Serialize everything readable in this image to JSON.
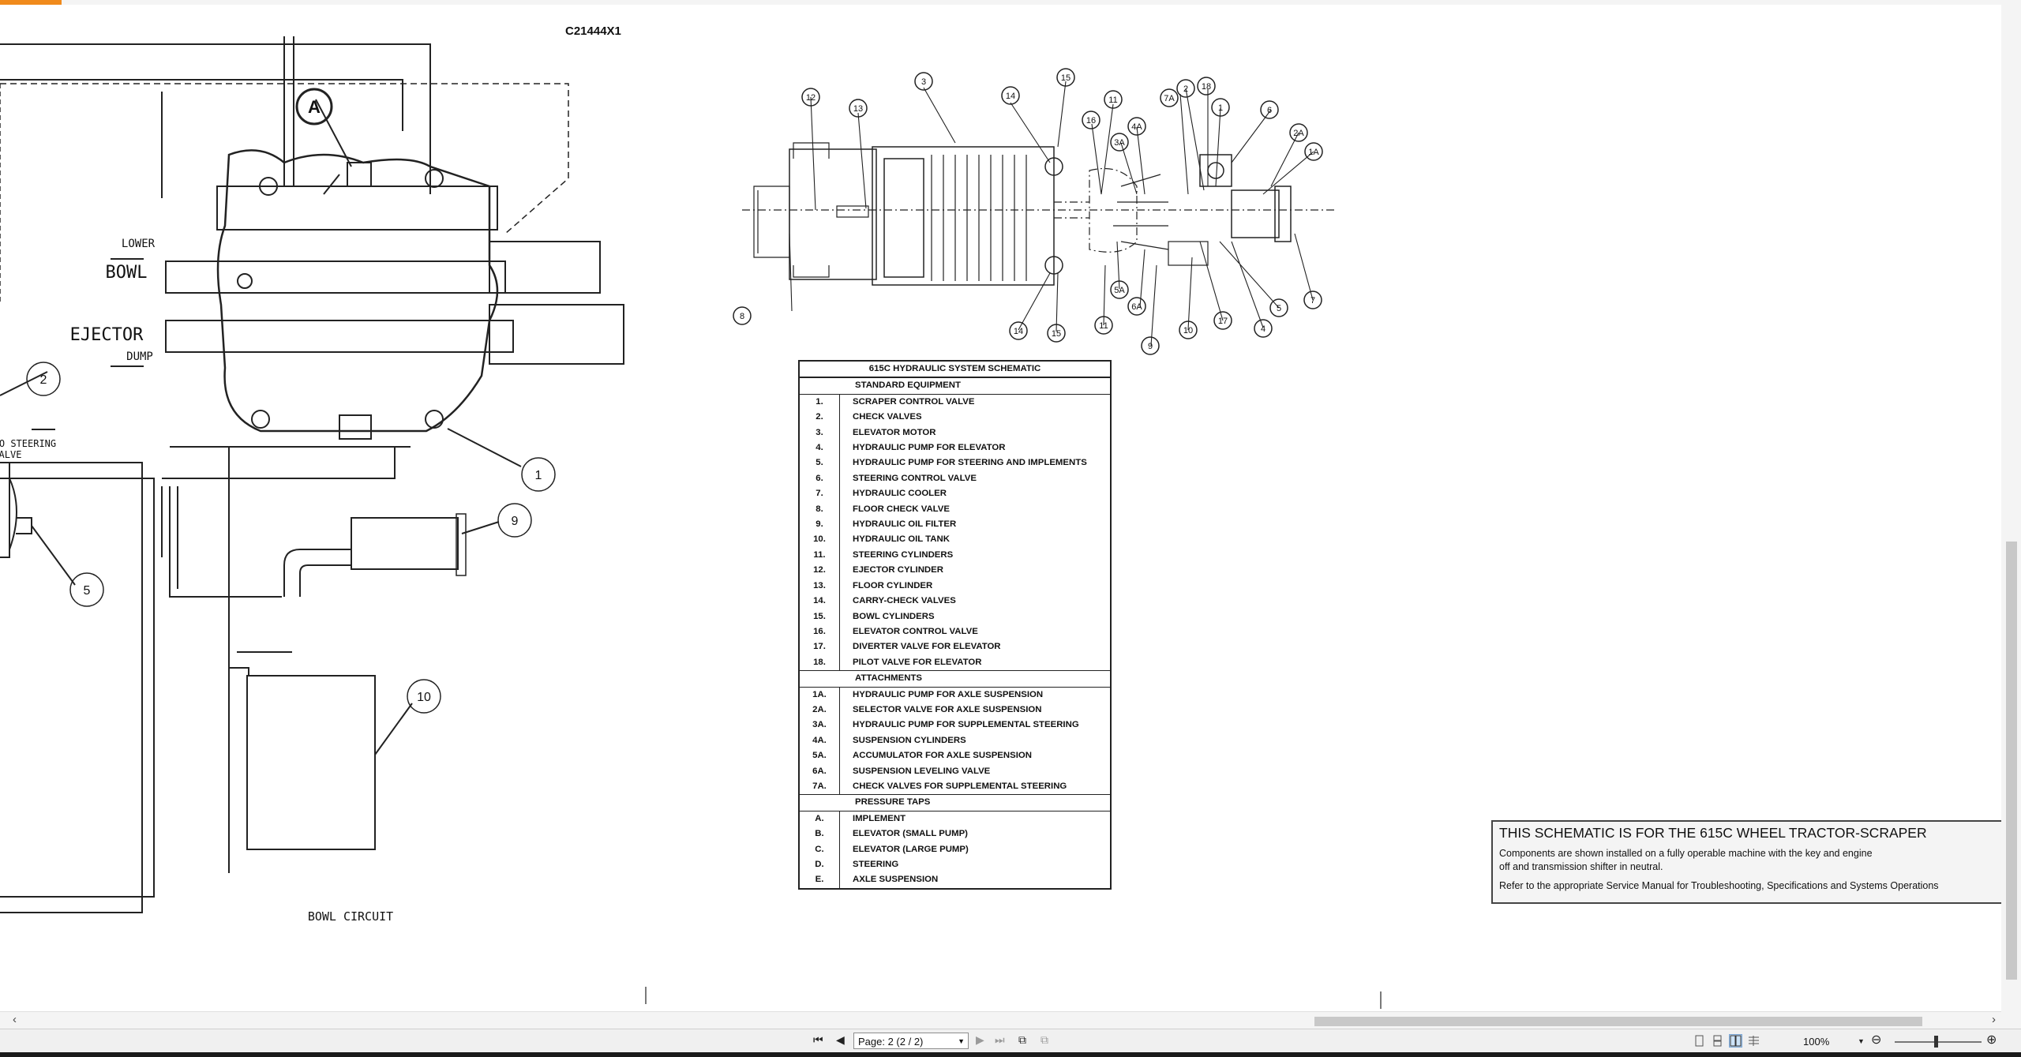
{
  "document": {
    "id": "C21444X1",
    "circuit_label": "BOWL CIRCUIT",
    "valve_labels": {
      "lower": "LOWER",
      "bowl": "BOWL",
      "ejector": "EJECTOR",
      "dump": "DUMP",
      "to_steering_1": "O STEERING",
      "to_steering_2": "ALVE"
    },
    "left_callouts": [
      "A",
      "2",
      "1",
      "9",
      "5",
      "10"
    ],
    "layout_callouts": [
      "12",
      "13",
      "3",
      "14",
      "15",
      "16",
      "11",
      "7A",
      "2",
      "18",
      "1",
      "6",
      "2A",
      "1A",
      "3A",
      "4A",
      "8",
      "14",
      "15",
      "11",
      "5A",
      "6A",
      "9",
      "10",
      "17",
      "4",
      "5",
      "7"
    ]
  },
  "legend": {
    "title": "615C HYDRAULIC SYSTEM SCHEMATIC",
    "sections": [
      {
        "heading": "STANDARD EQUIPMENT",
        "items": [
          {
            "num": "1.",
            "name": "SCRAPER CONTROL VALVE"
          },
          {
            "num": "2.",
            "name": "CHECK VALVES"
          },
          {
            "num": "3.",
            "name": "ELEVATOR MOTOR"
          },
          {
            "num": "4.",
            "name": "HYDRAULIC PUMP FOR ELEVATOR"
          },
          {
            "num": "5.",
            "name": "HYDRAULIC PUMP FOR STEERING AND IMPLEMENTS"
          },
          {
            "num": "6.",
            "name": "STEERING CONTROL VALVE"
          },
          {
            "num": "7.",
            "name": "HYDRAULIC COOLER"
          },
          {
            "num": "8.",
            "name": "FLOOR CHECK VALVE"
          },
          {
            "num": "9.",
            "name": "HYDRAULIC OIL FILTER"
          },
          {
            "num": "10.",
            "name": "HYDRAULIC OIL TANK"
          },
          {
            "num": "11.",
            "name": "STEERING CYLINDERS"
          },
          {
            "num": "12.",
            "name": "EJECTOR CYLINDER"
          },
          {
            "num": "13.",
            "name": "FLOOR CYLINDER"
          },
          {
            "num": "14.",
            "name": "CARRY-CHECK VALVES"
          },
          {
            "num": "15.",
            "name": "BOWL CYLINDERS"
          },
          {
            "num": "16.",
            "name": "ELEVATOR CONTROL VALVE"
          },
          {
            "num": "17.",
            "name": "DIVERTER VALVE FOR ELEVATOR"
          },
          {
            "num": "18.",
            "name": "PILOT VALVE FOR ELEVATOR"
          }
        ]
      },
      {
        "heading": "ATTACHMENTS",
        "items": [
          {
            "num": "1A.",
            "name": "HYDRAULIC PUMP FOR AXLE SUSPENSION"
          },
          {
            "num": "2A.",
            "name": "SELECTOR VALVE FOR AXLE SUSPENSION"
          },
          {
            "num": "3A.",
            "name": "HYDRAULIC PUMP FOR SUPPLEMENTAL STEERING"
          },
          {
            "num": "4A.",
            "name": "SUSPENSION CYLINDERS"
          },
          {
            "num": "5A.",
            "name": "ACCUMULATOR FOR AXLE SUSPENSION"
          },
          {
            "num": "6A.",
            "name": "SUSPENSION LEVELING VALVE"
          },
          {
            "num": "7A.",
            "name": "CHECK VALVES FOR SUPPLEMENTAL STEERING"
          }
        ]
      },
      {
        "heading": "PRESSURE TAPS",
        "items": [
          {
            "num": "A.",
            "name": "IMPLEMENT"
          },
          {
            "num": "B.",
            "name": "ELEVATOR (SMALL PUMP)"
          },
          {
            "num": "C.",
            "name": "ELEVATOR (LARGE PUMP)"
          },
          {
            "num": "D.",
            "name": "STEERING"
          },
          {
            "num": "E.",
            "name": "AXLE SUSPENSION"
          }
        ]
      }
    ]
  },
  "note": {
    "title": "THIS SCHEMATIC IS FOR THE 615C WHEEL TRACTOR-SCRAPER",
    "line1": "Components are shown installed on a fully operable machine with the key and engine",
    "line2": "off and transmission shifter in neutral.",
    "line3": "Refer to the appropriate Service Manual for Troubleshooting, Specifications and Systems Operations"
  },
  "statusbar": {
    "page_field": "Page: 2 (2 / 2)",
    "zoom": "100%"
  },
  "colors": {
    "accent": "#f08a1c",
    "note_bg": "#f4f4f4"
  }
}
